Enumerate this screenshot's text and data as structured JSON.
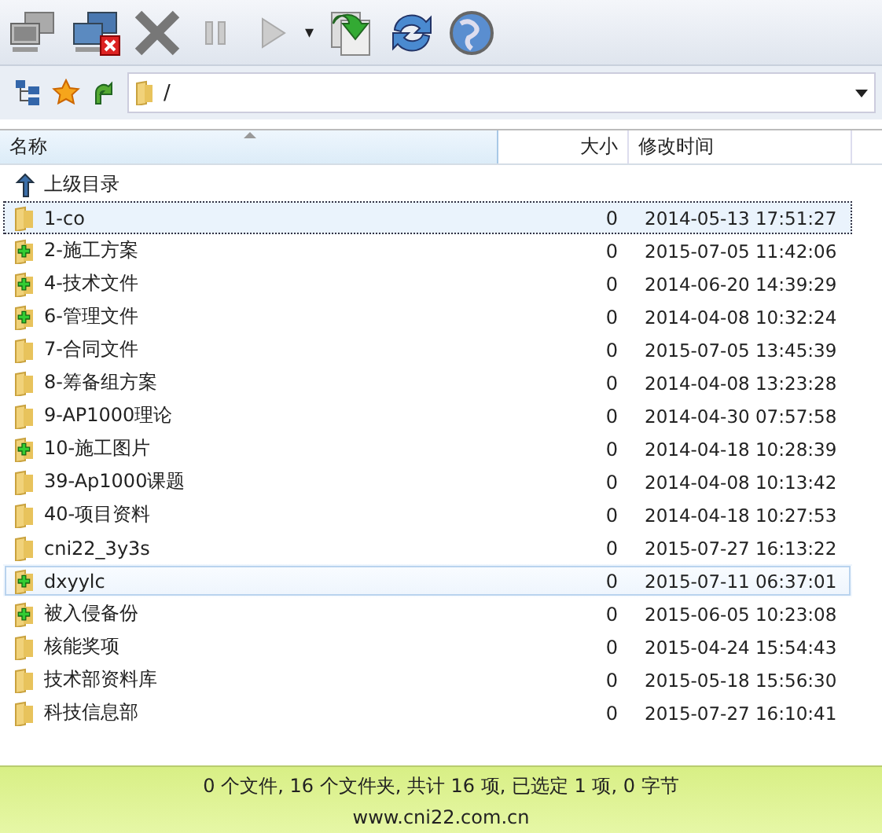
{
  "toolbar": {
    "dropdown_caret": "▾"
  },
  "address": {
    "path": "/"
  },
  "table": {
    "columns": [
      {
        "label": "名称",
        "sorted": true
      },
      {
        "label": "大小",
        "sorted": false
      },
      {
        "label": "修改时间",
        "sorted": false
      }
    ],
    "parent_row": {
      "label": "上级目录"
    },
    "rows": [
      {
        "name": "1-co",
        "kind": "folder",
        "size": "0",
        "modified": "2014-05-13 17:51:27",
        "selected": true,
        "hovered": false
      },
      {
        "name": "2-施工方案",
        "kind": "folder-plus",
        "size": "0",
        "modified": "2015-07-05 11:42:06",
        "selected": false,
        "hovered": false
      },
      {
        "name": "4-技术文件",
        "kind": "folder-plus",
        "size": "0",
        "modified": "2014-06-20 14:39:29",
        "selected": false,
        "hovered": false
      },
      {
        "name": "6-管理文件",
        "kind": "folder-plus",
        "size": "0",
        "modified": "2014-04-08 10:32:24",
        "selected": false,
        "hovered": false
      },
      {
        "name": "7-合同文件",
        "kind": "folder",
        "size": "0",
        "modified": "2015-07-05 13:45:39",
        "selected": false,
        "hovered": false
      },
      {
        "name": "8-筹备组方案",
        "kind": "folder",
        "size": "0",
        "modified": "2014-04-08 13:23:28",
        "selected": false,
        "hovered": false
      },
      {
        "name": "9-AP1000理论",
        "kind": "folder",
        "size": "0",
        "modified": "2014-04-30 07:57:58",
        "selected": false,
        "hovered": false
      },
      {
        "name": "10-施工图片",
        "kind": "folder-plus",
        "size": "0",
        "modified": "2014-04-18 10:28:39",
        "selected": false,
        "hovered": false
      },
      {
        "name": "39-Ap1000课题",
        "kind": "folder",
        "size": "0",
        "modified": "2014-04-08 10:13:42",
        "selected": false,
        "hovered": false
      },
      {
        "name": "40-项目资料",
        "kind": "folder",
        "size": "0",
        "modified": "2014-04-18 10:27:53",
        "selected": false,
        "hovered": false
      },
      {
        "name": "cni22_3y3s",
        "kind": "folder",
        "size": "0",
        "modified": "2015-07-27 16:13:22",
        "selected": false,
        "hovered": false
      },
      {
        "name": "dxyylc",
        "kind": "folder-plus",
        "size": "0",
        "modified": "2015-07-11 06:37:01",
        "selected": false,
        "hovered": true
      },
      {
        "name": "被入侵备份",
        "kind": "folder-plus",
        "size": "0",
        "modified": "2015-06-05 10:23:08",
        "selected": false,
        "hovered": false
      },
      {
        "name": "核能奖项",
        "kind": "folder",
        "size": "0",
        "modified": "2015-04-24 15:54:43",
        "selected": false,
        "hovered": false
      },
      {
        "name": "技术部资料库",
        "kind": "folder",
        "size": "0",
        "modified": "2015-05-18 15:56:30",
        "selected": false,
        "hovered": false
      },
      {
        "name": "科技信息部",
        "kind": "folder",
        "size": "0",
        "modified": "2015-07-27 16:10:41",
        "selected": false,
        "hovered": false
      }
    ]
  },
  "status_bar": {
    "summary": "0 个文件, 16 个文件夹, 共计 16 项, 已选定 1 项, 0 字节",
    "site": "www.cni22.com.cn"
  }
}
